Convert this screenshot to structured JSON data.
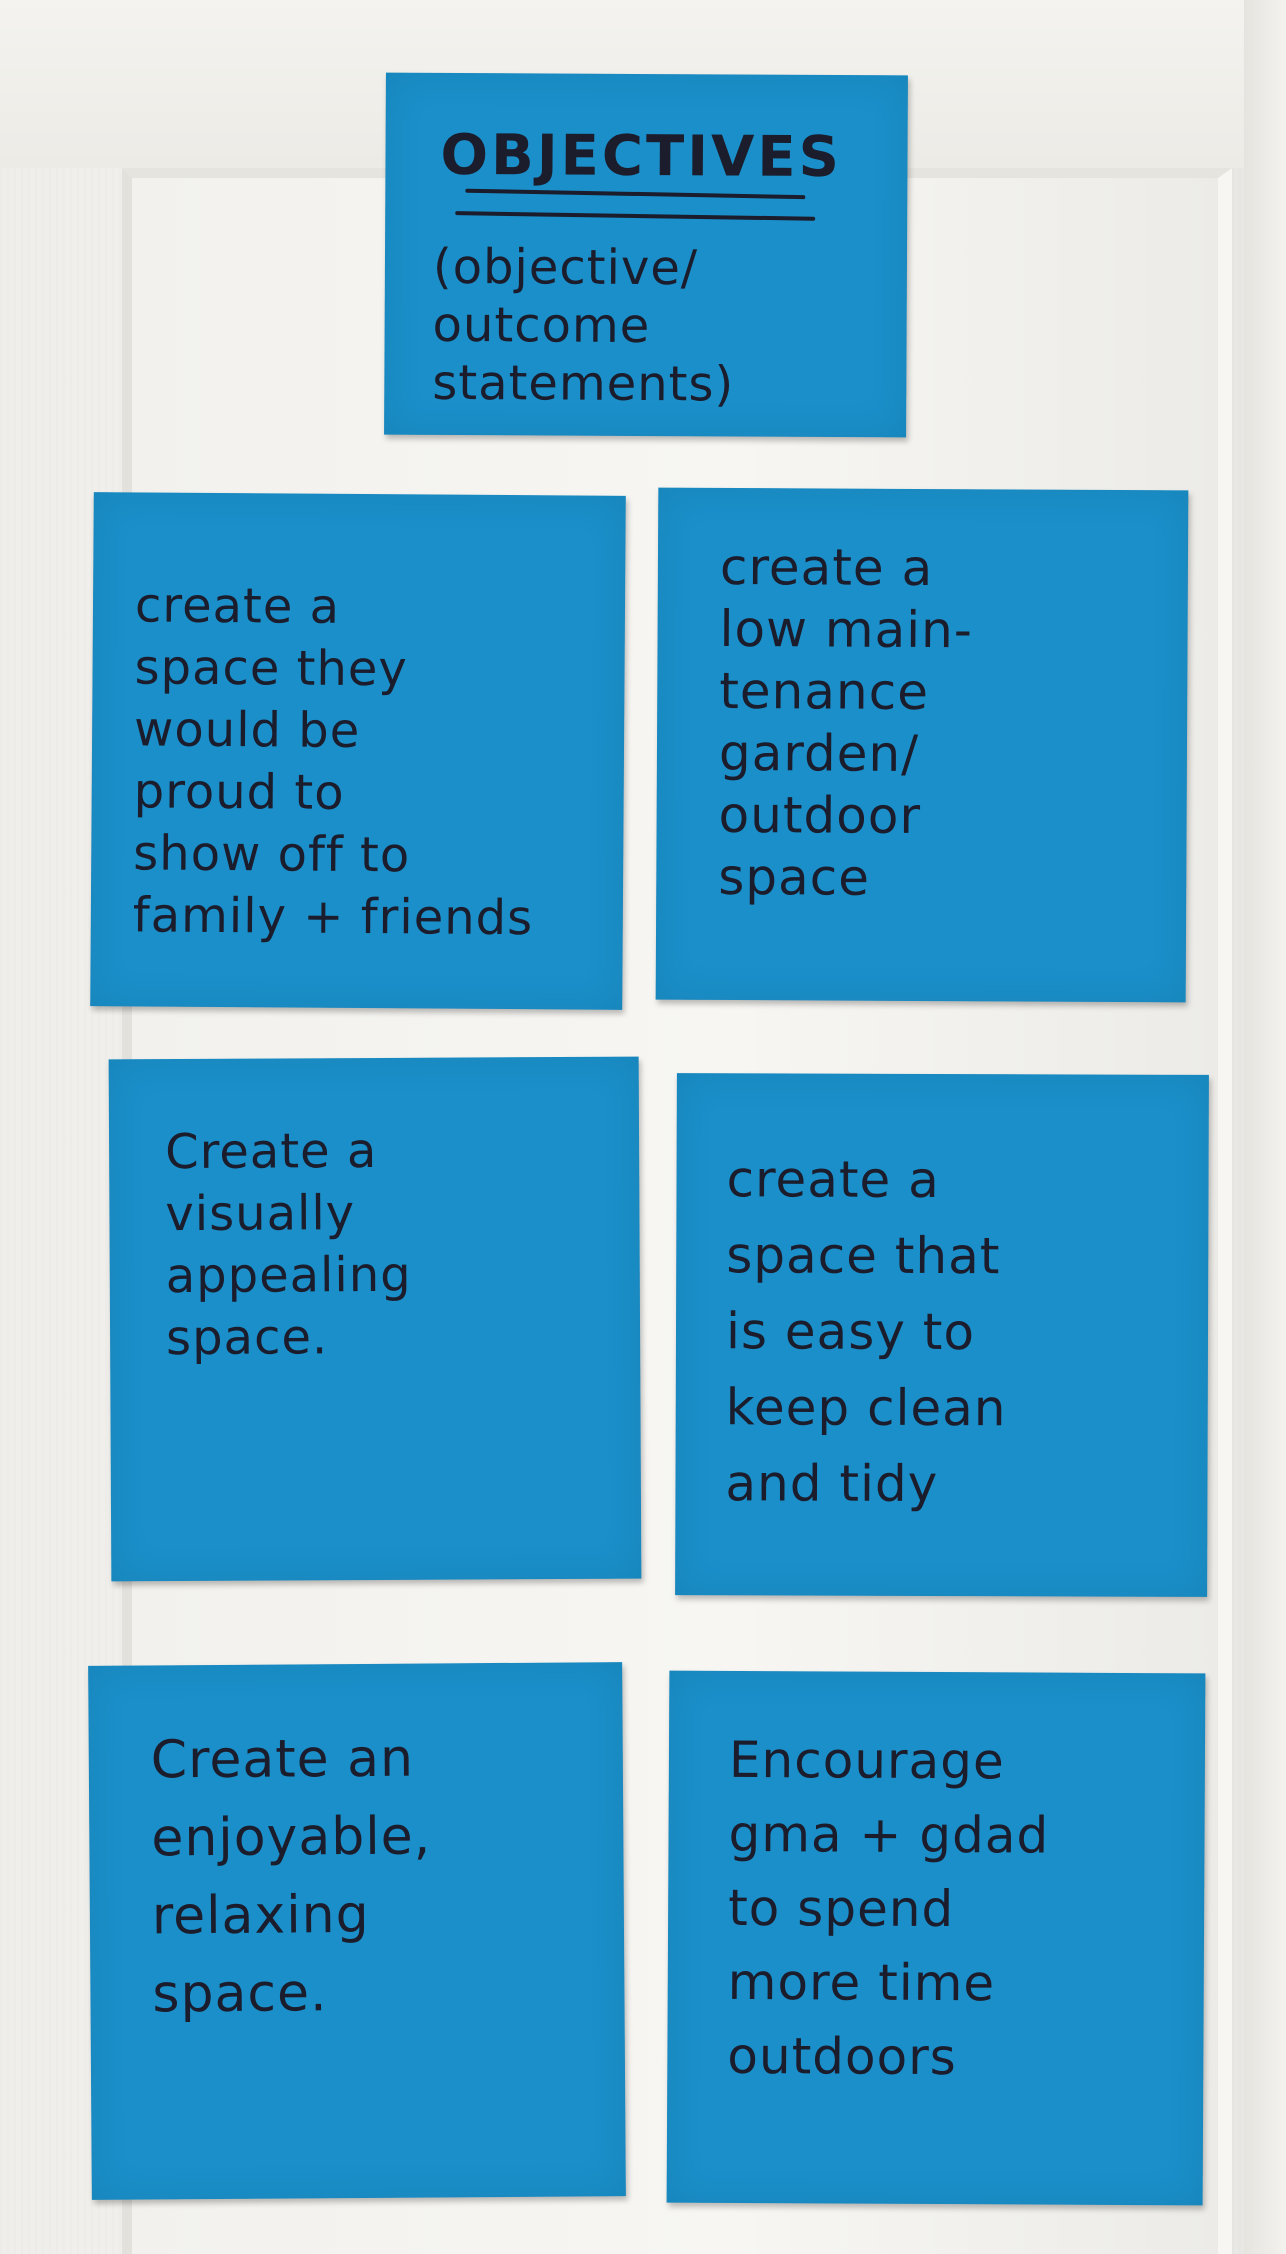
{
  "notes": {
    "title": {
      "heading": "OBJECTIVES",
      "subtitle": "(objective/\noutcome\nstatements)"
    },
    "items": [
      {
        "text": "create a\nspace they\nwould be\nproud to\nshow off to\nfamily + friends"
      },
      {
        "text": "create a\nlow main-\ntenance\ngarden/\noutdoor\nspace"
      },
      {
        "text": "Create a\nvisually\nappealing\nspace."
      },
      {
        "text": "create a\nspace that\nis easy to\nkeep clean\nand tidy"
      },
      {
        "text": "Create an\nenjoyable,\nrelaxing\nspace."
      },
      {
        "text": "Encourage\ngma + gdad\nto spend\nmore time\noutdoors"
      }
    ]
  },
  "colors": {
    "note": "#1a8fc9",
    "ink": "#1b1c2c",
    "door": "#efeeea"
  }
}
